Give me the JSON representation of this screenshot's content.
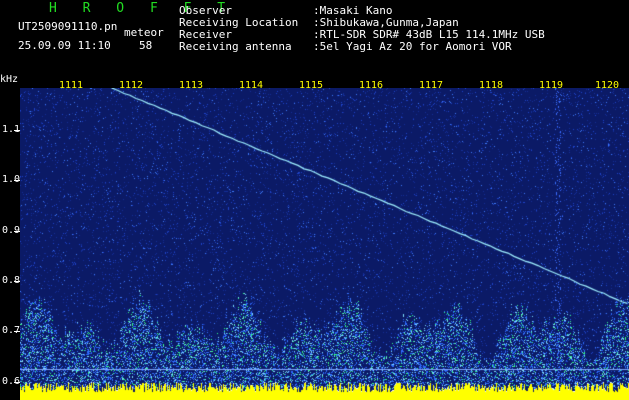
{
  "header": {
    "brand": "H R O F F T",
    "file_name": "UT2509091110.pn",
    "file_suffix": "meteor",
    "datetime": "25.09.09 11:10",
    "seconds": "58",
    "fields": [
      {
        "label": "Observer",
        "value": ":Masaki Kano"
      },
      {
        "label": "Receiving Location",
        "value": ":Shibukawa,Gunma,Japan"
      },
      {
        "label": "Receiver",
        "value": ":RTL-SDR SDR# 43dB L15 114.1MHz USB"
      },
      {
        "label": "Receiving antenna",
        "value": ":5el Yagi Az 20 for Aomori VOR"
      }
    ]
  },
  "chart_data": {
    "type": "heatmap",
    "yunit": "kHz",
    "x_ticks": [
      "1111",
      "1112",
      "1113",
      "1114",
      "1115",
      "1116",
      "1117",
      "1118",
      "1119",
      "1120"
    ],
    "y_ticks": [
      "1.1",
      "1.0",
      "0.9",
      "0.8",
      "0.7",
      "0.6"
    ],
    "ylim": [
      0.58,
      1.19
    ],
    "colors": {
      "background": "#0b1a66",
      "noise": "#2a5aff",
      "signal": "#9ff0ff",
      "carrier_band": "#ffff00",
      "tick_text": "#ffff00"
    }
  }
}
